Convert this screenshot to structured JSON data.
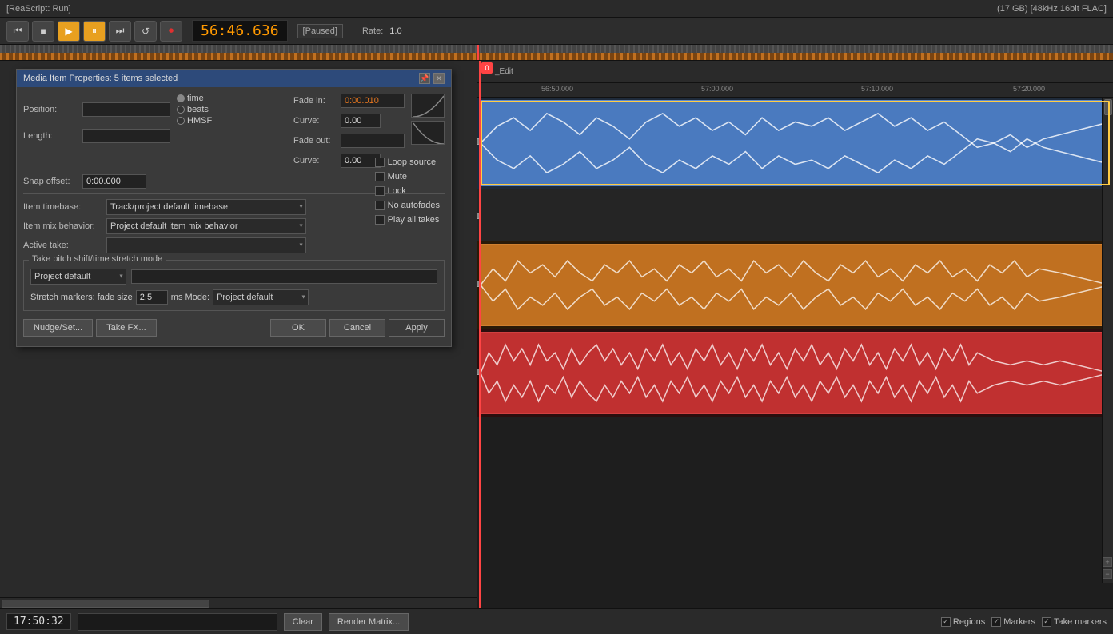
{
  "titlebar": {
    "left": "[ReaScript: Run]",
    "right": "(17 GB) [48kHz 16bit FLAC]"
  },
  "transport": {
    "time": "56:46.636",
    "status": "[Paused]",
    "rate_label": "Rate:",
    "rate_value": "1.0"
  },
  "dialog": {
    "title": "Media Item Properties:  5 items selected",
    "position_label": "Position:",
    "length_label": "Length:",
    "snap_label": "Snap offset:",
    "snap_value": "0:00.000",
    "radio_time": "time",
    "radio_beats": "beats",
    "radio_hmsf": "HMSF",
    "fade_in_label": "Fade in:",
    "fade_in_value": "0:00.010",
    "fade_in_curve_label": "Curve:",
    "fade_in_curve_value": "0.00",
    "fade_out_label": "Fade out:",
    "fade_out_curve_value": "0.00",
    "item_timebase_label": "Item timebase:",
    "item_timebase_value": "Track/project default timebase",
    "item_mix_label": "Item mix behavior:",
    "item_mix_value": "Project default item mix behavior",
    "active_take_label": "Active take:",
    "active_take_value": "",
    "loop_source": "Loop source",
    "mute": "Mute",
    "lock": "Lock",
    "no_autofades": "No autofades",
    "play_all_takes": "Play all takes",
    "pitch_group_title": "Take pitch shift/time stretch mode",
    "pitch_dropdown": "Project default",
    "stretch_fade_label": "Stretch markers: fade size",
    "stretch_fade_value": "2.5",
    "stretch_ms_label": "ms  Mode:",
    "stretch_mode_value": "Project default",
    "nudge_btn": "Nudge/Set...",
    "take_fx_btn": "Take FX...",
    "ok_btn": "OK",
    "cancel_btn": "Cancel",
    "apply_btn": "Apply"
  },
  "timeline": {
    "edit_label": "0",
    "edit_text": "_Edit",
    "markers": [
      "56:50.000",
      "57:00.000",
      "57:10.000",
      "57:20.000"
    ],
    "playhead_left": "0"
  },
  "statusbar": {
    "time": "17:50:32",
    "clear_btn": "Clear",
    "render_btn": "Render Matrix...",
    "regions_label": "Regions",
    "markers_label": "Markers",
    "take_markers_label": "Take markers"
  }
}
